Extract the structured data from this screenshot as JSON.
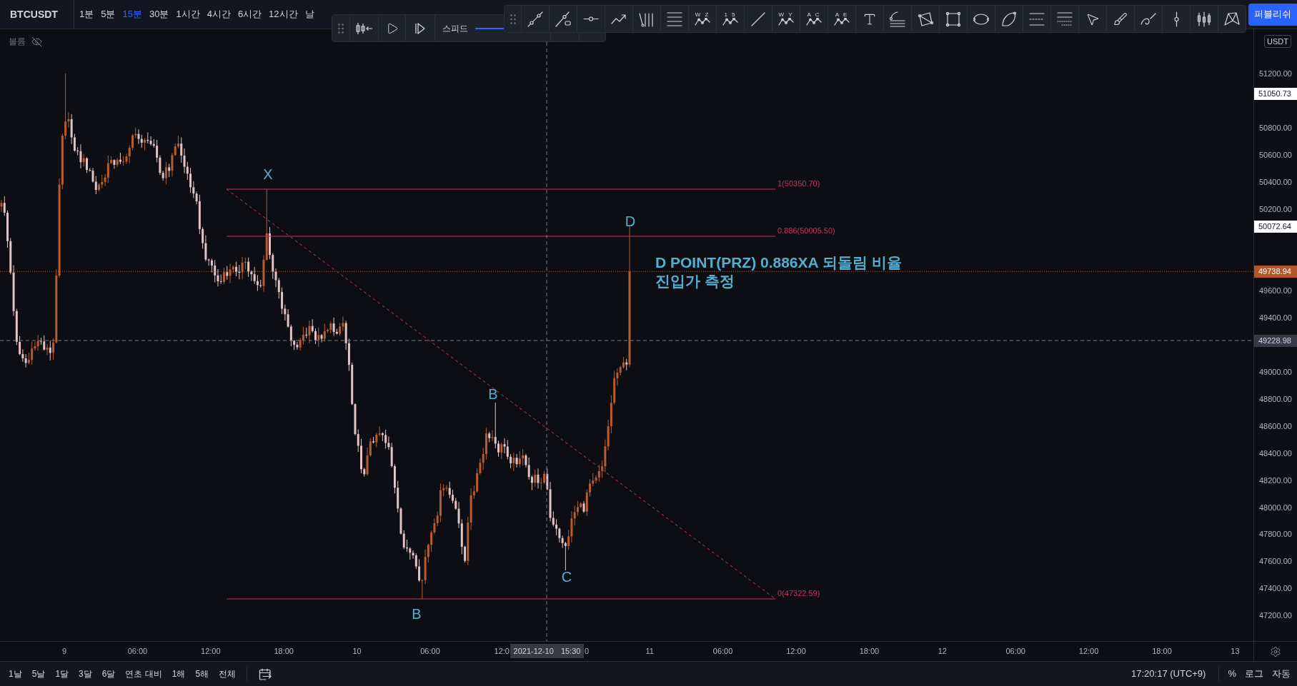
{
  "top_bar": {
    "symbol": "BTCUSDT",
    "intervals": [
      {
        "label": "1분",
        "selected": false
      },
      {
        "label": "5분",
        "selected": false
      },
      {
        "label": "15분",
        "selected": true
      },
      {
        "label": "30분",
        "selected": false
      },
      {
        "label": "1시간",
        "selected": false
      },
      {
        "label": "4시간",
        "selected": false
      },
      {
        "label": "6시간",
        "selected": false
      },
      {
        "label": "12시간",
        "selected": false
      },
      {
        "label": "날",
        "selected": false
      }
    ],
    "publish_label": "퍼블리쉬"
  },
  "replay_toolbar": {
    "speed_label": "스피드",
    "speed_slider": {
      "level": 1
    }
  },
  "drawing_toolbar": {
    "tools": [
      {
        "kind": "trend_line"
      },
      {
        "kind": "ray"
      },
      {
        "kind": "horizontal_ray"
      },
      {
        "kind": "arrow_path"
      },
      {
        "kind": "pitchfork"
      },
      {
        "kind": "fib_retracement"
      },
      {
        "kind": "wave",
        "letters": "W Z"
      },
      {
        "kind": "wave",
        "letters": "1 5"
      },
      {
        "kind": "line"
      },
      {
        "kind": "wave",
        "letters": "W Y"
      },
      {
        "kind": "wave",
        "letters": "A C"
      },
      {
        "kind": "wave",
        "letters": "A E"
      },
      {
        "kind": "text"
      },
      {
        "kind": "fib_channel"
      },
      {
        "kind": "polygon"
      },
      {
        "kind": "rectangle"
      },
      {
        "kind": "ellipse"
      },
      {
        "kind": "arc"
      },
      {
        "kind": "long_short"
      },
      {
        "kind": "projection"
      },
      {
        "kind": "cursor"
      },
      {
        "kind": "brush"
      },
      {
        "kind": "pen"
      },
      {
        "kind": "vertical_line"
      },
      {
        "kind": "candles"
      },
      {
        "kind": "xabcd"
      }
    ]
  },
  "chart": {
    "legend": {
      "label": "볼륨",
      "visible": false
    },
    "pattern_points": [
      {
        "label": "X"
      },
      {
        "label": "D"
      },
      {
        "label": "B"
      },
      {
        "label": "C"
      },
      {
        "label": "B"
      }
    ],
    "fib_levels": [
      {
        "label": "1(50350.70)"
      },
      {
        "label": "0.886(50005.50)"
      },
      {
        "label": "0(47322.59)"
      }
    ],
    "annotation": {
      "text": "D POINT(PRZ) 0.886XA 되돌림 비율\n진입가 측정"
    }
  },
  "price_axis": {
    "currency": "USDT",
    "ticks": [
      "51200.00",
      "50800.00",
      "50600.00",
      "50400.00",
      "50200.00",
      "49600.00",
      "49400.00",
      "49000.00",
      "48800.00",
      "48600.00",
      "48400.00",
      "48200.00",
      "48000.00",
      "47800.00",
      "47600.00",
      "47400.00",
      "47200.00"
    ],
    "price_labels": [
      {
        "text": "51050.73",
        "kind": "marker"
      },
      {
        "text": "50072.64",
        "kind": "marker"
      },
      {
        "text": "49738.94",
        "kind": "last"
      },
      {
        "text": "49228.98",
        "kind": "crosshair"
      }
    ]
  },
  "time_axis": {
    "ticks": [
      "9",
      "06:00",
      "12:00",
      "18:00",
      "10",
      "06:00",
      "12:0",
      "0",
      "11",
      "06:00",
      "12:00",
      "18:00",
      "12",
      "06:00",
      "12:00",
      "18:00",
      "13"
    ],
    "crosshair_label": "2021-12-10 15:30"
  },
  "bottom_bar": {
    "ranges": [
      "1날",
      "5날",
      "1달",
      "3달",
      "6달",
      "연초 대비",
      "1해",
      "5해",
      "전체"
    ],
    "clock": "17:20:17 (UTC+9)",
    "options": [
      "%",
      "로그",
      "자동"
    ]
  }
}
